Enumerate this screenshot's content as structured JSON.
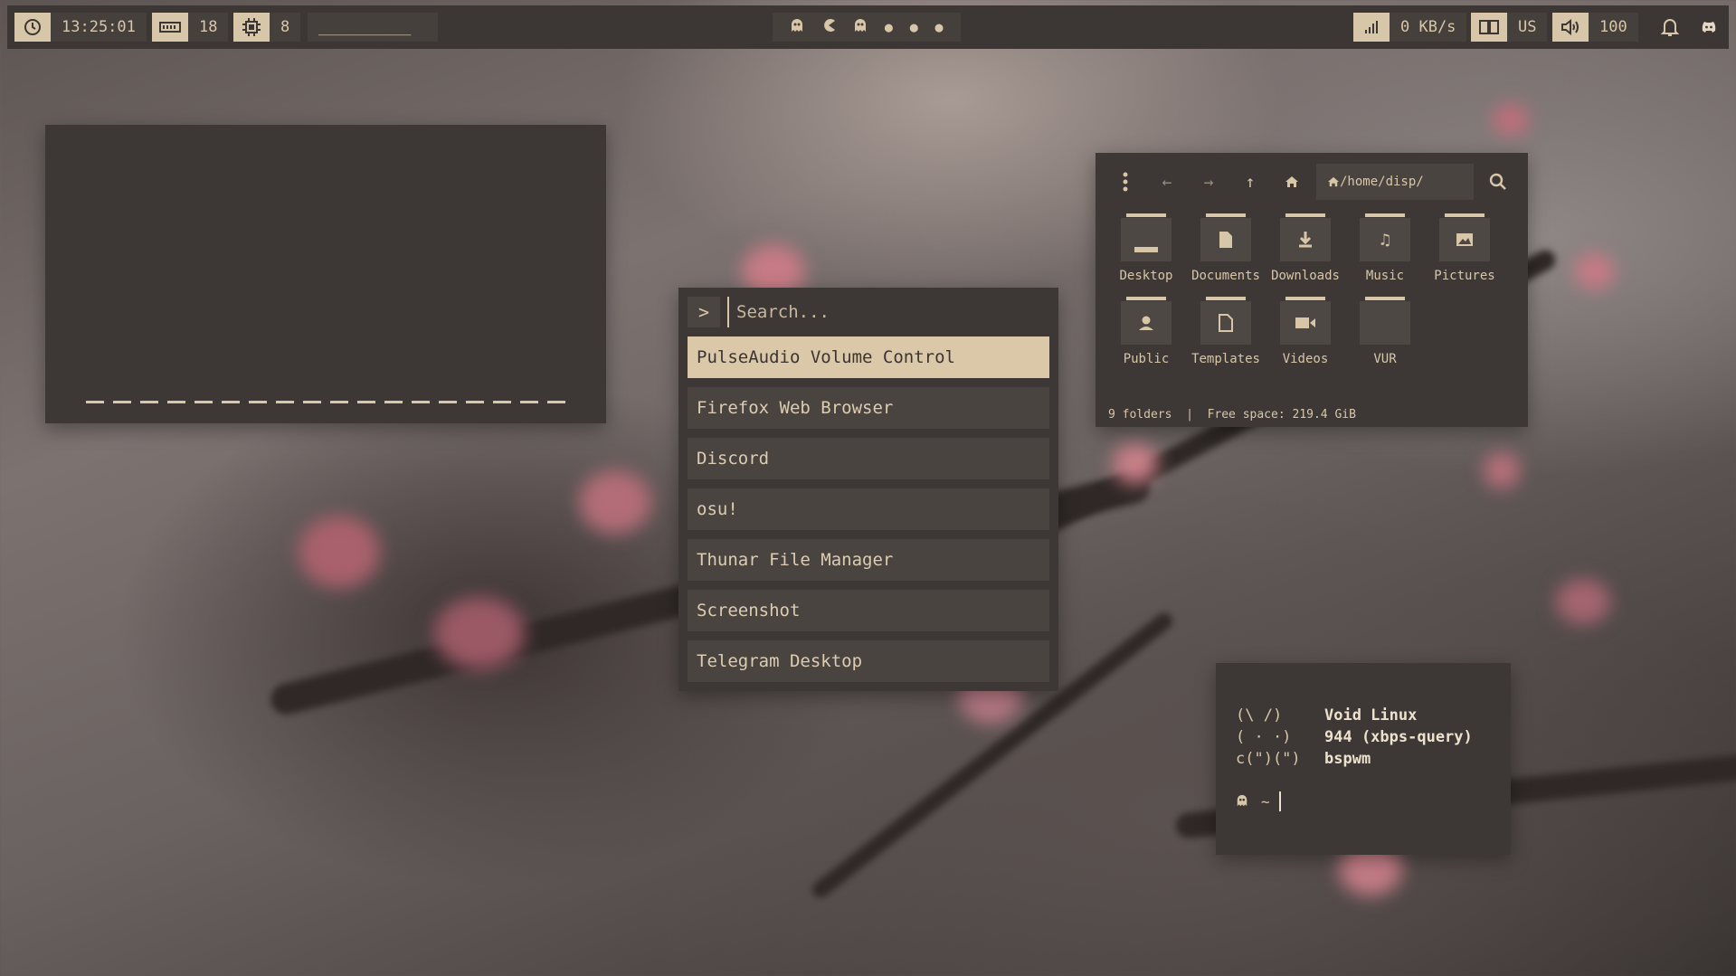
{
  "colors": {
    "accent": "#d8c6a8",
    "panel_bg": "#3d3836",
    "bar_bg": "#3c3735"
  },
  "topbar": {
    "clock": {
      "icon": "clock-icon",
      "time": "13:25:01"
    },
    "memory": {
      "icon": "memory-icon",
      "value": "18"
    },
    "cpu": {
      "icon": "cpu-icon",
      "value": "8"
    },
    "window_title": "__________",
    "workspaces": [
      {
        "icon": "ghost-icon"
      },
      {
        "icon": "pacman-icon"
      },
      {
        "icon": "ghost-icon"
      },
      {
        "icon": "dot-icon"
      },
      {
        "icon": "dot-icon"
      },
      {
        "icon": "dot-icon"
      }
    ],
    "network": {
      "icon": "signal-bars-icon",
      "value": "0 KB/s"
    },
    "keyboard": {
      "icon": "keyboard-layout-icon",
      "value": "US"
    },
    "volume": {
      "icon": "speaker-icon",
      "value": "100"
    },
    "notifications_icon": "bell-icon",
    "discord_icon": "discord-icon"
  },
  "launcher": {
    "prompt": ">",
    "placeholder": "Search...",
    "items": [
      "PulseAudio Volume Control",
      "Firefox Web Browser",
      "Discord",
      "osu!",
      "Thunar File Manager",
      "Screenshot",
      "Telegram Desktop"
    ],
    "selected_index": 0
  },
  "file_manager": {
    "path": "/home/disp/",
    "folders": [
      {
        "label": "Desktop",
        "icon": "desktop-folder-icon"
      },
      {
        "label": "Documents",
        "icon": "document-folder-icon"
      },
      {
        "label": "Downloads",
        "icon": "download-folder-icon"
      },
      {
        "label": "Music",
        "icon": "music-folder-icon"
      },
      {
        "label": "Pictures",
        "icon": "picture-folder-icon"
      },
      {
        "label": "Public",
        "icon": "public-folder-icon"
      },
      {
        "label": "Templates",
        "icon": "template-folder-icon"
      },
      {
        "label": "Videos",
        "icon": "video-folder-icon"
      },
      {
        "label": "VUR",
        "icon": "folder-icon"
      }
    ],
    "status": "9 folders  |  Free space: 219.4 GiB"
  },
  "terminal": {
    "lines": [
      {
        "art": "(\\ /)",
        "value": "Void Linux"
      },
      {
        "art": "( · ·)",
        "value": "944 (xbps-query)"
      },
      {
        "art": "c(\")(\")",
        "value": "bspwm"
      }
    ],
    "prompt": "~"
  }
}
